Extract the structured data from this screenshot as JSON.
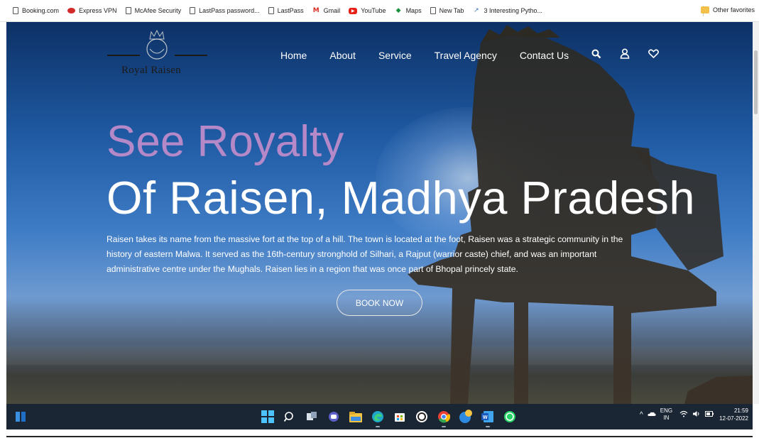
{
  "bookmarks": [
    {
      "label": "Booking.com",
      "icon": "page-icon"
    },
    {
      "label": "Express VPN",
      "icon": "expressvpn-icon"
    },
    {
      "label": "McAfee Security",
      "icon": "page-icon"
    },
    {
      "label": "LastPass password...",
      "icon": "page-icon"
    },
    {
      "label": "LastPass",
      "icon": "page-icon"
    },
    {
      "label": "Gmail",
      "icon": "gmail-icon"
    },
    {
      "label": "YouTube",
      "icon": "youtube-icon"
    },
    {
      "label": "Maps",
      "icon": "maps-icon"
    },
    {
      "label": "New Tab",
      "icon": "page-icon"
    },
    {
      "label": "3 Interesting Pytho...",
      "icon": "chart-icon"
    }
  ],
  "other_favorites": "Other favorites",
  "site": {
    "logo_text": "Royal Raisen",
    "nav": [
      "Home",
      "About",
      "Service",
      "Travel Agency",
      "Contact Us"
    ],
    "nav_icons": [
      "search-icon",
      "user-icon",
      "heart-icon"
    ]
  },
  "hero": {
    "headline1": "See Royalty",
    "headline2": "Of Raisen, Madhya Pradesh",
    "description": "Raisen takes its name from the massive fort at the top of a hill. The town is located at the foot, Raisen was a strategic community in the history of eastern Malwa. It served as the 16th-century stronghold of Silhari, a Rajput (warrior caste) chief, and was an important administrative centre under the Mughals. Raisen lies in a region that was once part of Bhopal princely state.",
    "cta": "BOOK NOW"
  },
  "taskbar": {
    "apps": [
      "windows-start-icon",
      "search-icon",
      "task-view-icon",
      "chat-icon",
      "file-explorer-icon",
      "edge-icon",
      "store-icon",
      "app-icon",
      "chrome-icon",
      "app-icon",
      "word-icon",
      "whatsapp-icon"
    ],
    "lang_line1": "ENG",
    "lang_line2": "IN",
    "time": "21:59",
    "date": "12-07-2022"
  },
  "colors": {
    "accent": "#b588c8",
    "taskbar": "#1b2634",
    "sky_top": "#0d3166"
  }
}
